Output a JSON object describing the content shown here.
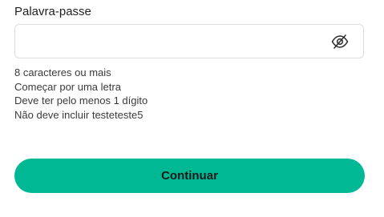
{
  "password": {
    "label": "Palavra-passe",
    "value": "",
    "placeholder": "",
    "toggle_icon": "eye-slash-icon"
  },
  "requirements": [
    "8 caracteres ou mais",
    "Começar por uma letra",
    "Deve ter pelo menos 1 dígito",
    "Não deve incluir testeteste5"
  ],
  "actions": {
    "continue_label": "Continuar"
  },
  "colors": {
    "accent": "#00b894",
    "border": "#dcdcdc",
    "text": "#222222"
  }
}
